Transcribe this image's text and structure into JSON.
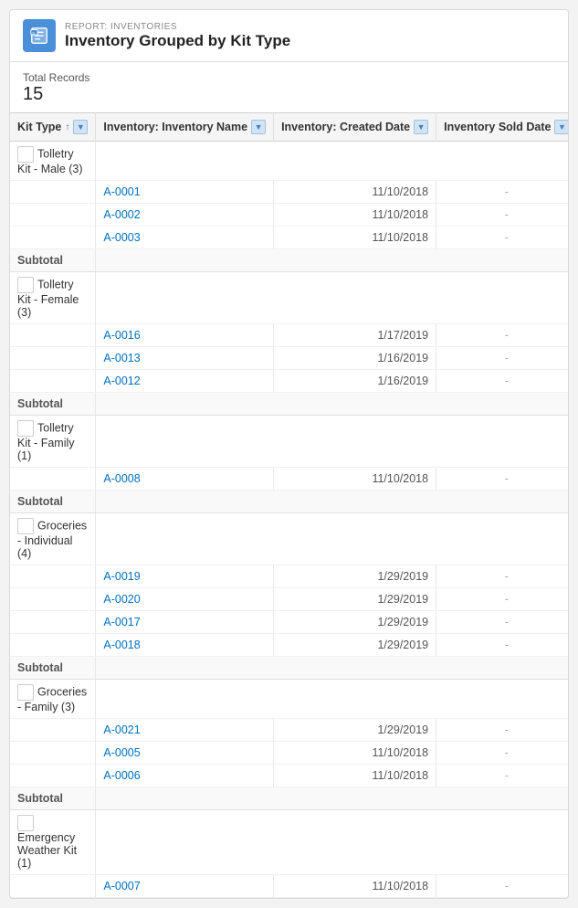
{
  "header": {
    "subtitle": "REPORT: INVENTORIES",
    "title": "Inventory Grouped by Kit Type"
  },
  "summary": {
    "label": "Total Records",
    "value": "15"
  },
  "columns": [
    {
      "label": "Kit Type",
      "sort": "↑",
      "filter": true
    },
    {
      "label": "Inventory: Inventory Name",
      "sort": "",
      "filter": true
    },
    {
      "label": "Inventory: Created Date",
      "sort": "",
      "filter": true
    },
    {
      "label": "Inventory Sold Date",
      "sort": "",
      "filter": true
    }
  ],
  "groups": [
    {
      "name": "Tolletry Kit - Male (3)",
      "rows": [
        {
          "inv_name": "A-0001",
          "created": "11/10/2018",
          "sold": "-"
        },
        {
          "inv_name": "A-0002",
          "created": "11/10/2018",
          "sold": "-"
        },
        {
          "inv_name": "A-0003",
          "created": "11/10/2018",
          "sold": "-"
        }
      ],
      "subtotal": "Subtotal"
    },
    {
      "name": "Tolletry Kit - Female (3)",
      "rows": [
        {
          "inv_name": "A-0016",
          "created": "1/17/2019",
          "sold": "-"
        },
        {
          "inv_name": "A-0013",
          "created": "1/16/2019",
          "sold": "-"
        },
        {
          "inv_name": "A-0012",
          "created": "1/16/2019",
          "sold": "-"
        }
      ],
      "subtotal": "Subtotal"
    },
    {
      "name": "Tolletry Kit - Family (1)",
      "rows": [
        {
          "inv_name": "A-0008",
          "created": "11/10/2018",
          "sold": "-"
        }
      ],
      "subtotal": "Subtotal"
    },
    {
      "name": "Groceries - Individual (4)",
      "rows": [
        {
          "inv_name": "A-0019",
          "created": "1/29/2019",
          "sold": "-"
        },
        {
          "inv_name": "A-0020",
          "created": "1/29/2019",
          "sold": "-"
        },
        {
          "inv_name": "A-0017",
          "created": "1/29/2019",
          "sold": "-"
        },
        {
          "inv_name": "A-0018",
          "created": "1/29/2019",
          "sold": "-"
        }
      ],
      "subtotal": "Subtotal"
    },
    {
      "name": "Groceries - Family (3)",
      "rows": [
        {
          "inv_name": "A-0021",
          "created": "1/29/2019",
          "sold": "-"
        },
        {
          "inv_name": "A-0005",
          "created": "11/10/2018",
          "sold": "-"
        },
        {
          "inv_name": "A-0006",
          "created": "11/10/2018",
          "sold": "-"
        }
      ],
      "subtotal": "Subtotal"
    },
    {
      "name": "Emergency Weather Kit (1)",
      "rows": [
        {
          "inv_name": "A-0007",
          "created": "11/10/2018",
          "sold": "-"
        }
      ],
      "subtotal": null
    }
  ],
  "icons": {
    "report": "📋",
    "filter": "▼"
  }
}
